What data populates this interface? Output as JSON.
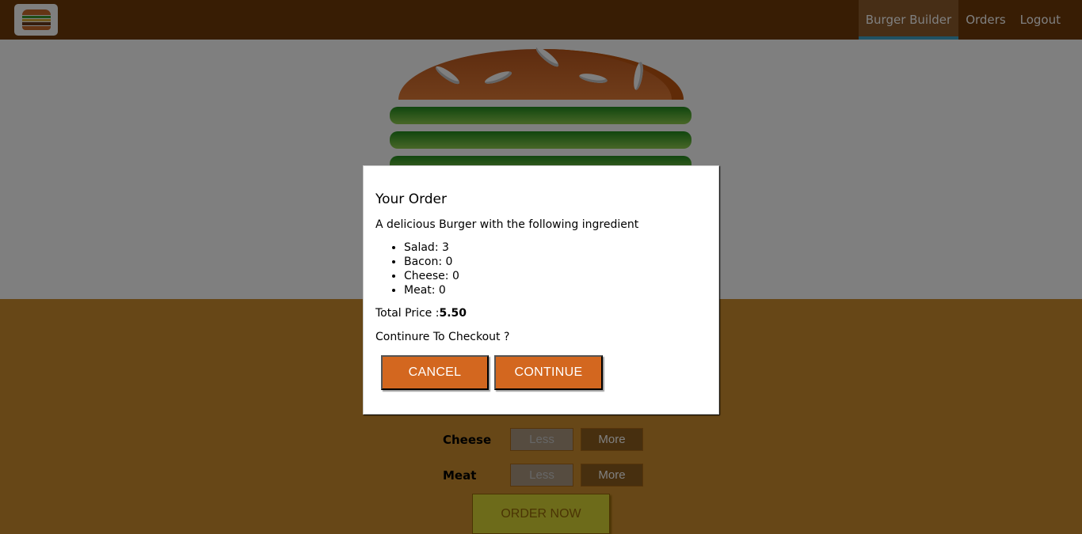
{
  "nav": {
    "items": [
      {
        "label": "Burger Builder",
        "active": true
      },
      {
        "label": "Orders",
        "active": false
      },
      {
        "label": "Logout",
        "active": false
      }
    ]
  },
  "controls": {
    "rows": [
      {
        "label": "Cheese",
        "less": "Less",
        "more": "More"
      },
      {
        "label": "Meat",
        "less": "Less",
        "more": "More"
      }
    ],
    "order_button": "ORDER NOW"
  },
  "modal": {
    "title": "Your Order",
    "description": "A delicious Burger with the following ingredient",
    "ingredients": [
      "Salad: 3",
      "Bacon: 0",
      "Cheese: 0",
      "Meat: 0"
    ],
    "price_label": "Total Price :",
    "price_value": "5.50",
    "confirm_text": "Continure To Checkout ?",
    "cancel_label": "CANCEL",
    "continue_label": "CONTINUE"
  },
  "colors": {
    "toolbar": "#703b09",
    "modal_button": "#d3671f",
    "controls_bg": "#cf8f2e"
  }
}
